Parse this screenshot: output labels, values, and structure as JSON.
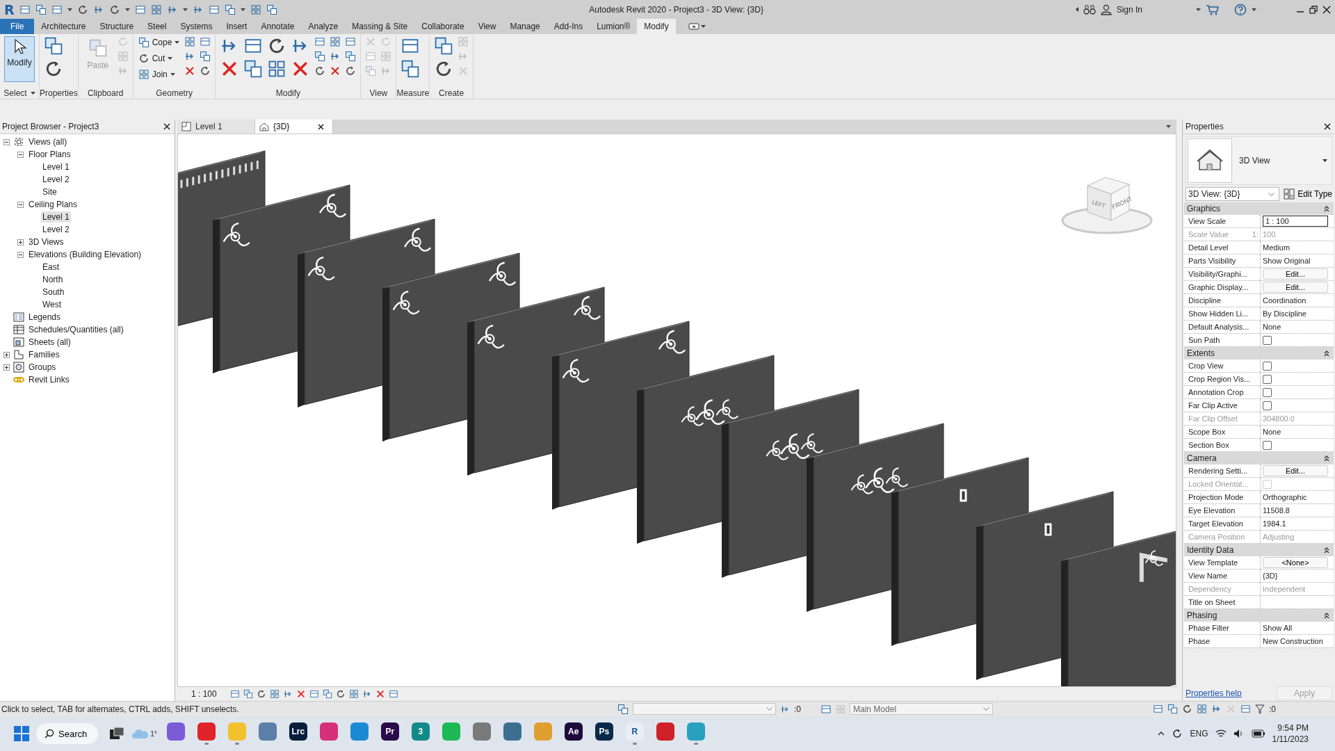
{
  "title_bar": {
    "logo": "R",
    "title": "Autodesk Revit 2020 - Project3 - 3D View: {3D}",
    "sign_in": "Sign In"
  },
  "ribbon": {
    "tabs": [
      {
        "label": "File",
        "kind": "menu",
        "selected": false
      },
      {
        "label": "Architecture",
        "kind": "tab",
        "selected": false
      },
      {
        "label": "Structure",
        "kind": "tab",
        "selected": false
      },
      {
        "label": "Steel",
        "kind": "tab",
        "selected": false
      },
      {
        "label": "Systems",
        "kind": "tab",
        "selected": false
      },
      {
        "label": "Insert",
        "kind": "tab",
        "selected": false
      },
      {
        "label": "Annotate",
        "kind": "tab",
        "selected": false
      },
      {
        "label": "Analyze",
        "kind": "tab",
        "selected": false
      },
      {
        "label": "Massing & Site",
        "kind": "tab",
        "selected": false
      },
      {
        "label": "Collaborate",
        "kind": "tab",
        "selected": false
      },
      {
        "label": "View",
        "kind": "tab",
        "selected": false
      },
      {
        "label": "Manage",
        "kind": "tab",
        "selected": false
      },
      {
        "label": "Add-Ins",
        "kind": "tab",
        "selected": false
      },
      {
        "label": "Lumion®",
        "kind": "tab",
        "selected": false
      },
      {
        "label": "Modify",
        "kind": "tab",
        "selected": true
      }
    ],
    "panels": [
      {
        "label": "Select",
        "dropdown": true,
        "buttons": [
          {
            "label": "Modify",
            "kind": "large",
            "selected": true,
            "disabled": false
          }
        ]
      },
      {
        "label": "Properties"
      },
      {
        "label": "Clipboard",
        "buttons": [
          {
            "label": "Paste",
            "kind": "large",
            "selected": false,
            "disabled": true
          }
        ]
      },
      {
        "label": "Geometry",
        "buttons": [
          {
            "label": "Cope",
            "kind": "small",
            "selected": false,
            "disabled": false
          },
          {
            "label": "Cut",
            "kind": "small",
            "selected": false,
            "disabled": false
          },
          {
            "label": "Join",
            "kind": "small",
            "selected": false,
            "disabled": false
          }
        ]
      },
      {
        "label": "Modify"
      },
      {
        "label": "View"
      },
      {
        "label": "Measure"
      },
      {
        "label": "Create"
      }
    ]
  },
  "project_browser": {
    "title": "Project Browser - Project3",
    "tree": [
      {
        "label": "Views (all)",
        "expanded": true,
        "selected": false,
        "children": [
          {
            "label": "Floor Plans",
            "expanded": true,
            "selected": false,
            "children": [
              {
                "label": "Level 1",
                "selected": false
              },
              {
                "label": "Level 2",
                "selected": false
              },
              {
                "label": "Site",
                "selected": false
              }
            ]
          },
          {
            "label": "Ceiling Plans",
            "expanded": true,
            "selected": false,
            "children": [
              {
                "label": "Level 1",
                "selected": true
              },
              {
                "label": "Level 2",
                "selected": false
              }
            ]
          },
          {
            "label": "3D Views",
            "expanded": false,
            "selected": false
          },
          {
            "label": "Elevations (Building Elevation)",
            "expanded": true,
            "selected": false,
            "children": [
              {
                "label": "East",
                "selected": false
              },
              {
                "label": "North",
                "selected": false
              },
              {
                "label": "South",
                "selected": false
              },
              {
                "label": "West",
                "selected": false
              }
            ]
          }
        ]
      },
      {
        "label": "Legends",
        "selected": false
      },
      {
        "label": "Schedules/Quantities (all)",
        "selected": false
      },
      {
        "label": "Sheets (all)",
        "selected": false
      },
      {
        "label": "Families",
        "expanded": false,
        "selected": false
      },
      {
        "label": "Groups",
        "expanded": false,
        "selected": false
      },
      {
        "label": "Revit Links",
        "selected": false
      }
    ]
  },
  "view": {
    "tabs": [
      {
        "label": "Level 1",
        "kind": "plan",
        "selected": false
      },
      {
        "label": "{3D}",
        "kind": "model",
        "selected": true
      }
    ],
    "view_cube": {
      "left": "LEFT",
      "front": "FRONT"
    },
    "scale": "1 : 100"
  },
  "properties": {
    "title": "Properties",
    "type_name": "3D View",
    "selector": "3D View: {3D}",
    "edit_type": "Edit Type",
    "groups": [
      {
        "name": "Graphics",
        "expanded": true,
        "rows": [
          {
            "label": "View Scale",
            "kind": "field",
            "value": "1 : 100",
            "disabled": false
          },
          {
            "label": "Scale Value",
            "unit": "1:",
            "kind": "text",
            "value": "100",
            "disabled": true
          },
          {
            "label": "Detail Level",
            "kind": "text",
            "value": "Medium",
            "disabled": false
          },
          {
            "label": "Parts Visibility",
            "kind": "text",
            "value": "Show Original",
            "disabled": false
          },
          {
            "label": "Visibility/Graphi...",
            "kind": "button",
            "value": "Edit...",
            "disabled": false
          },
          {
            "label": "Graphic Display...",
            "kind": "button",
            "value": "Edit...",
            "disabled": false
          },
          {
            "label": "Discipline",
            "kind": "text",
            "value": "Coordination",
            "disabled": false
          },
          {
            "label": "Show Hidden Li...",
            "kind": "text",
            "value": "By Discipline",
            "disabled": false
          },
          {
            "label": "Default Analysis...",
            "kind": "text",
            "value": "None",
            "disabled": false
          },
          {
            "label": "Sun Path",
            "kind": "checkbox",
            "checked": false,
            "disabled": false
          }
        ]
      },
      {
        "name": "Extents",
        "expanded": true,
        "rows": [
          {
            "label": "Crop View",
            "kind": "checkbox",
            "checked": false,
            "disabled": false
          },
          {
            "label": "Crop Region Vis...",
            "kind": "checkbox",
            "checked": false,
            "disabled": false
          },
          {
            "label": "Annotation Crop",
            "kind": "checkbox",
            "checked": false,
            "disabled": false
          },
          {
            "label": "Far Clip Active",
            "kind": "checkbox",
            "checked": false,
            "disabled": false
          },
          {
            "label": "Far Clip Offset",
            "kind": "text",
            "value": "304800.0",
            "disabled": true
          },
          {
            "label": "Scope Box",
            "kind": "text",
            "value": "None",
            "disabled": false
          },
          {
            "label": "Section Box",
            "kind": "checkbox",
            "checked": false,
            "disabled": false
          }
        ]
      },
      {
        "name": "Camera",
        "expanded": true,
        "rows": [
          {
            "label": "Rendering Setti...",
            "kind": "button",
            "value": "Edit...",
            "disabled": false
          },
          {
            "label": "Locked Orientat...",
            "kind": "checkbox",
            "checked": false,
            "disabled": true
          },
          {
            "label": "Projection Mode",
            "kind": "text",
            "value": "Orthographic",
            "disabled": false
          },
          {
            "label": "Eye Elevation",
            "kind": "text",
            "value": "11508.8",
            "disabled": false
          },
          {
            "label": "Target Elevation",
            "kind": "text",
            "value": "1984.1",
            "disabled": false
          },
          {
            "label": "Camera Position",
            "kind": "text",
            "value": "Adjusting",
            "disabled": true
          }
        ]
      },
      {
        "name": "Identity Data",
        "expanded": true,
        "rows": [
          {
            "label": "View Template",
            "kind": "button",
            "value": "<None>",
            "disabled": false
          },
          {
            "label": "View Name",
            "kind": "text",
            "value": "{3D}",
            "disabled": false
          },
          {
            "label": "Dependency",
            "kind": "text",
            "value": "Independent",
            "disabled": true
          },
          {
            "label": "Title on Sheet",
            "kind": "text",
            "disabled": false
          }
        ]
      },
      {
        "name": "Phasing",
        "expanded": true,
        "rows": [
          {
            "label": "Phase Filter",
            "kind": "text",
            "value": "Show All",
            "disabled": false
          },
          {
            "label": "Phase",
            "kind": "text",
            "value": "New Construction",
            "disabled": false
          }
        ]
      }
    ],
    "help": "Properties help",
    "apply": "Apply"
  },
  "status_bar": {
    "message": "Click to select, TAB for alternates, CTRL adds, SHIFT unselects.",
    "selection_count": ":0",
    "model": "Main Model",
    "filter_count": ":0"
  },
  "taskbar": {
    "search": "Search",
    "weather": "1°",
    "apps": [
      {
        "color": "#7b5cd6",
        "running": false
      },
      {
        "color": "#e0242a",
        "running": true
      },
      {
        "color": "#f2c12e",
        "running": true
      },
      {
        "color": "#5a7fa8",
        "running": false
      },
      {
        "label": "Lrc",
        "color": "#0a1e3c",
        "running": false
      },
      {
        "color": "#d6307a",
        "running": false
      },
      {
        "color": "#1b8ad3",
        "running": false
      },
      {
        "label": "Pr",
        "color": "#2a0a4a",
        "running": false
      },
      {
        "label": "3",
        "color": "#138a8a",
        "running": false
      },
      {
        "color": "#1db954",
        "running": false
      },
      {
        "color": "#7a7a7a",
        "running": false
      },
      {
        "color": "#3b6f8f",
        "running": false
      },
      {
        "color": "#e0a030",
        "running": false
      },
      {
        "label": "Ae",
        "color": "#1f0a3d",
        "running": false
      },
      {
        "label": "Ps",
        "color": "#0b2a4a",
        "running": false
      },
      {
        "label": "R",
        "color": "#e8eef5",
        "running": true
      },
      {
        "color": "#d0202a",
        "running": false
      },
      {
        "color": "#2aa0c0",
        "running": true
      }
    ],
    "language": "ENG",
    "time": "9:54 PM",
    "date": "1/11/2023"
  }
}
